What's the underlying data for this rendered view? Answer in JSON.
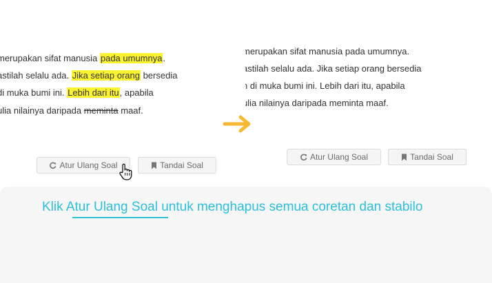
{
  "before_panel": {
    "line1": {
      "pre": "merupakan sifat manusia ",
      "hl": "pada umumnya",
      "post": "."
    },
    "line2": {
      "pre": "astilah selalu ada. ",
      "hl": "Jika setiap orang",
      "post": " bersedia"
    },
    "line3": {
      "pre": " di muka bumi ini. ",
      "hl": "Lebih dari itu",
      "post": ", apabila"
    },
    "line4": {
      "pre": "ulia nilainya daripada ",
      "strike": "meminta",
      "post": " maaf."
    }
  },
  "after_panel": {
    "lines": [
      "merupakan sifat manusia pada umumnya.",
      "astilah selalu ada. Jika setiap orang bersedia",
      "n di muka bumi ini. Lebih dari itu, apabila",
      "ulia nilainya daripada meminta maaf."
    ]
  },
  "buttons": {
    "reset_label": "Atur Ulang Soal",
    "mark_label": "Tandai Soal"
  },
  "instruction": {
    "prefix": "Klik ",
    "link": "Atur Ulang Soal",
    "suffix": " untuk menghapus semua coretan dan stabilo"
  },
  "colors": {
    "highlight": "#fbf32f",
    "arrow": "#f7b733",
    "accent": "#2cc0d8"
  },
  "icons": {
    "reset": "refresh-icon",
    "mark": "bookmark-icon",
    "pointer": "hand-cursor-icon",
    "transition": "arrow-right-icon"
  }
}
